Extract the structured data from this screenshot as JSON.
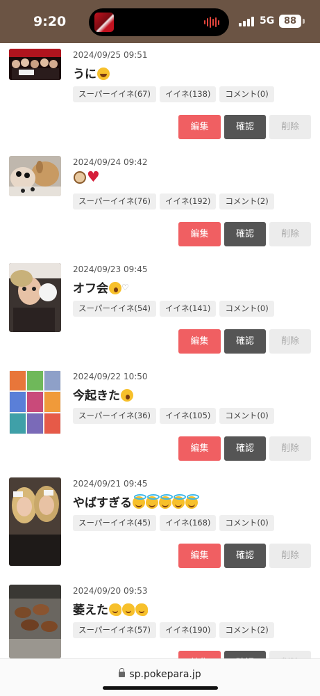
{
  "status_bar": {
    "time": "9:20",
    "network": "5G",
    "battery": "88"
  },
  "posts": [
    {
      "date": "2024/09/25 09:51",
      "title": "うに",
      "emojis": [
        "laugh"
      ],
      "super_like": "スーパーイイネ(67)",
      "like": "イイネ(138)",
      "comment": "コメント(0)"
    },
    {
      "date": "2024/09/24 09:42",
      "title": "",
      "emojis": [
        "dog",
        "heart"
      ],
      "super_like": "スーパーイイネ(76)",
      "like": "イイネ(192)",
      "comment": "コメント(2)"
    },
    {
      "date": "2024/09/23 09:45",
      "title": "オフ会",
      "emojis": [
        "yawn"
      ],
      "title_suffix": "♡",
      "super_like": "スーパーイイネ(54)",
      "like": "イイネ(141)",
      "comment": "コメント(0)"
    },
    {
      "date": "2024/09/22 10:50",
      "title": "今起きた",
      "emojis": [
        "yawn"
      ],
      "super_like": "スーパーイイネ(36)",
      "like": "イイネ(105)",
      "comment": "コメント(0)"
    },
    {
      "date": "2024/09/21 09:45",
      "title": "やばすぎる",
      "emojis": [
        "angel",
        "angel",
        "angel",
        "angel",
        "angel"
      ],
      "super_like": "スーパーイイネ(45)",
      "like": "イイネ(168)",
      "comment": "コメント(0)"
    },
    {
      "date": "2024/09/20 09:53",
      "title": "萎えた",
      "emojis": [
        "melt",
        "melt",
        "melt"
      ],
      "super_like": "スーパーイイネ(57)",
      "like": "イイネ(190)",
      "comment": "コメント(2)"
    }
  ],
  "buttons": {
    "edit": "編集",
    "confirm": "確認",
    "delete": "削除"
  },
  "url_bar": {
    "url": "sp.pokepara.jp"
  },
  "colors": {
    "status_bar": "#6b5444",
    "edit": "#f05f62",
    "confirm": "#555555",
    "delete": "#ececec"
  }
}
